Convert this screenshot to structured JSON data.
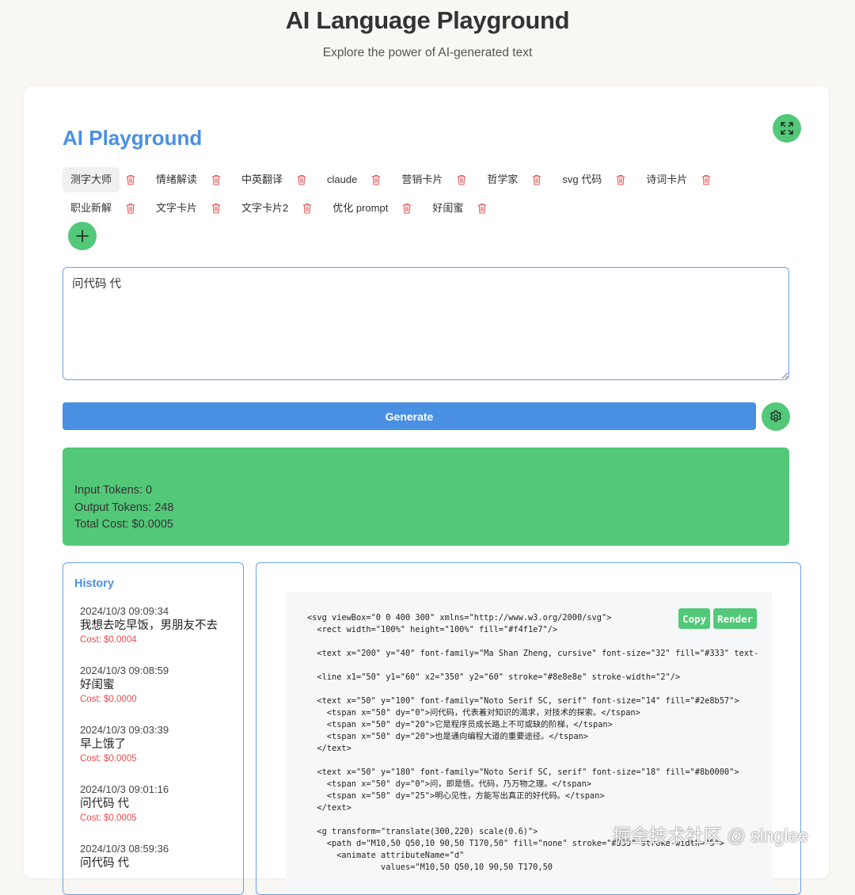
{
  "header": {
    "title": "AI Language Playground",
    "subtitle": "Explore the power of AI-generated text"
  },
  "playground": {
    "title": "AI Playground",
    "icons": {
      "fullscreen": "expand-icon",
      "add": "plus-icon",
      "settings": "gear-icon",
      "delete": "trash-icon"
    },
    "tabs": [
      {
        "label": "测字大师",
        "active": true
      },
      {
        "label": "情绪解读"
      },
      {
        "label": "中英翻译"
      },
      {
        "label": "claude"
      },
      {
        "label": "营销卡片"
      },
      {
        "label": "哲学家"
      },
      {
        "label": "svg 代码"
      },
      {
        "label": "诗词卡片"
      },
      {
        "label": "职业新解"
      },
      {
        "label": "文字卡片"
      },
      {
        "label": "文字卡片2"
      },
      {
        "label": "优化 prompt"
      },
      {
        "label": "好闺蜜"
      }
    ],
    "input_value": "问代码 代",
    "generate_label": "Generate"
  },
  "stats": {
    "input_tokens": "Input Tokens: 0",
    "output_tokens": "Output Tokens: 248",
    "total_cost": "Total Cost: $0.0005"
  },
  "history": {
    "title": "History",
    "items": [
      {
        "time": "2024/10/3 09:09:34",
        "text": "我想去吃早饭，男朋友不去",
        "cost": "Cost: $0.0004"
      },
      {
        "time": "2024/10/3 09:08:59",
        "text": "好闺蜜",
        "cost": "Cost: $0.0000"
      },
      {
        "time": "2024/10/3 09:03:39",
        "text": "早上饿了",
        "cost": "Cost: $0.0005"
      },
      {
        "time": "2024/10/3 09:01:16",
        "text": "问代码 代",
        "cost": "Cost: $0.0005"
      },
      {
        "time": "2024/10/3 08:59:36",
        "text": "问代码 代",
        "cost": ""
      }
    ]
  },
  "output": {
    "copy_label": "Copy",
    "render_label": "Render",
    "code": "<svg viewBox=\"0 0 400 300\" xmlns=\"http://www.w3.org/2000/svg\">\n  <rect width=\"100%\" height=\"100%\" fill=\"#f4f1e7\"/>\n\n  <text x=\"200\" y=\"40\" font-family=\"Ma Shan Zheng, cursive\" font-size=\"32\" fill=\"#333\" text-\n\n  <line x1=\"50\" y1=\"60\" x2=\"350\" y2=\"60\" stroke=\"#8e8e8e\" stroke-width=\"2\"/>\n\n  <text x=\"50\" y=\"100\" font-family=\"Noto Serif SC, serif\" font-size=\"14\" fill=\"#2e8b57\">\n    <tspan x=\"50\" dy=\"0\">问代码，代表着对知识的渴求，对技术的探索。</tspan>\n    <tspan x=\"50\" dy=\"20\">它是程序员成长路上不可或缺的阶梯，</tspan>\n    <tspan x=\"50\" dy=\"20\">也是通向编程大道的重要途径。</tspan>\n  </text>\n\n  <text x=\"50\" y=\"180\" font-family=\"Noto Serif SC, serif\" font-size=\"18\" fill=\"#8b0000\">\n    <tspan x=\"50\" dy=\"0\">问，即是悟。代码，乃万物之理。</tspan>\n    <tspan x=\"50\" dy=\"25\">明心见性，方能写出真正的好代码。</tspan>\n  </text>\n\n  <g transform=\"translate(300,220) scale(0.6)\">\n    <path d=\"M10,50 Q50,10 90,50 T170,50\" fill=\"none\" stroke=\"#333\" stroke-width=\"5\">\n      <animate attributeName=\"d\"\n               values=\"M10,50 Q50,10 90,50 T170,50"
  },
  "watermark": "掘金技术社区 @ singlee"
}
